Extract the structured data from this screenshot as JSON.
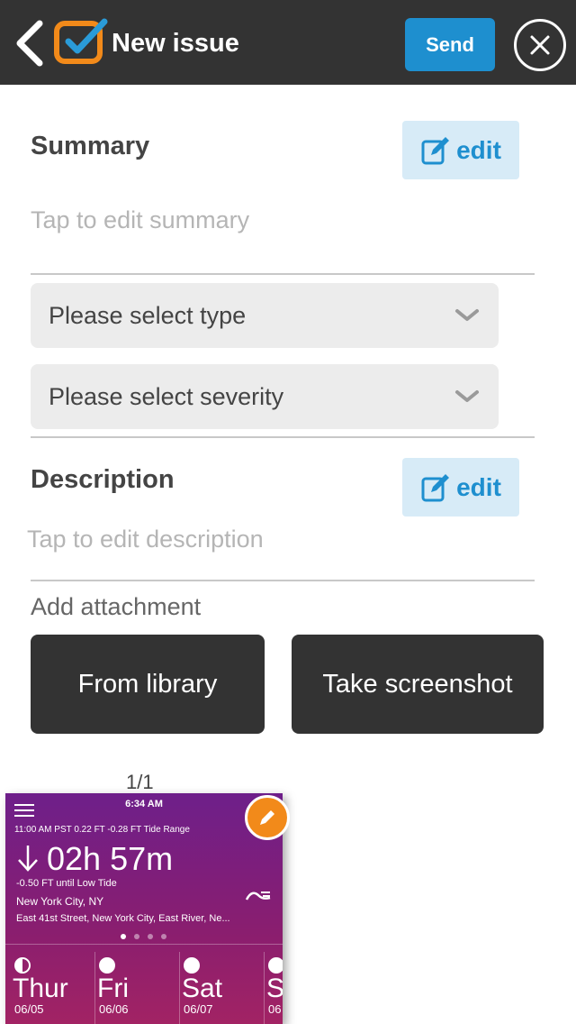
{
  "header": {
    "title": "New issue",
    "send_label": "Send",
    "colors": {
      "bar": "#333333",
      "send": "#1e8fcf",
      "logo": "#f28a1a"
    }
  },
  "summary": {
    "label": "Summary",
    "edit_label": "edit",
    "placeholder": "Tap to edit summary"
  },
  "type_select": {
    "value": "Please select type"
  },
  "severity_select": {
    "value": "Please select severity"
  },
  "description": {
    "label": "Description",
    "edit_label": "edit",
    "placeholder": "Tap to edit description"
  },
  "attachment": {
    "label": "Add attachment",
    "library_label": "From library",
    "screenshot_label": "Take screenshot",
    "counter": "1/1"
  },
  "thumbnail": {
    "time": "6:34 AM",
    "info": "11:00 AM PST    0.22 FT    -0.28 FT Tide Range",
    "countdown": "02h 57m",
    "until": "-0.50 FT until Low Tide",
    "city": "New York City, NY",
    "street": "East 41st Street, New York City, East River, Ne...",
    "days": [
      {
        "name": "Thur",
        "date": "06/05"
      },
      {
        "name": "Fri",
        "date": "06/06"
      },
      {
        "name": "Sat",
        "date": "06/07"
      },
      {
        "name": "S",
        "date": "06"
      }
    ],
    "colors": {
      "top": "#6e1f8a",
      "bottom": "#a22364",
      "edit_badge": "#f28a1a"
    }
  }
}
